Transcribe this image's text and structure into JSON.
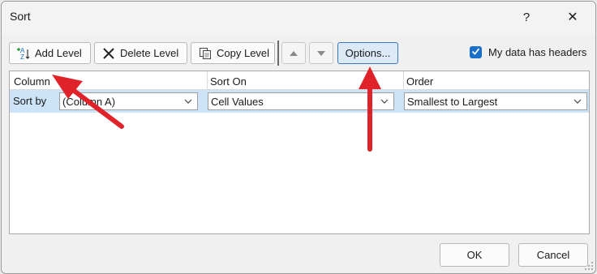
{
  "dialog": {
    "title": "Sort",
    "help_label": "?",
    "close_label": "✕"
  },
  "toolbar": {
    "add_level_label": "Add Level",
    "delete_level_label": "Delete Level",
    "copy_level_label": "Copy Level",
    "options_label": "Options...",
    "icons": {
      "add": "add-level-icon",
      "delete": "delete-icon",
      "copy": "copy-icon",
      "up": "move-up-icon",
      "down": "move-down-icon"
    }
  },
  "headers_checkbox": {
    "label": "My data has headers",
    "checked": true
  },
  "grid": {
    "columns": [
      "Column",
      "Sort On",
      "Order"
    ],
    "rows": [
      {
        "label": "Sort by",
        "column_value": "(Column A)",
        "sort_on_value": "Cell Values",
        "order_value": "Smallest to Largest"
      }
    ]
  },
  "footer": {
    "ok_label": "OK",
    "cancel_label": "Cancel"
  },
  "colors": {
    "accent": "#1a6fc9",
    "annotation_arrow": "#e0222b",
    "selected_row": "#cde3f7"
  }
}
